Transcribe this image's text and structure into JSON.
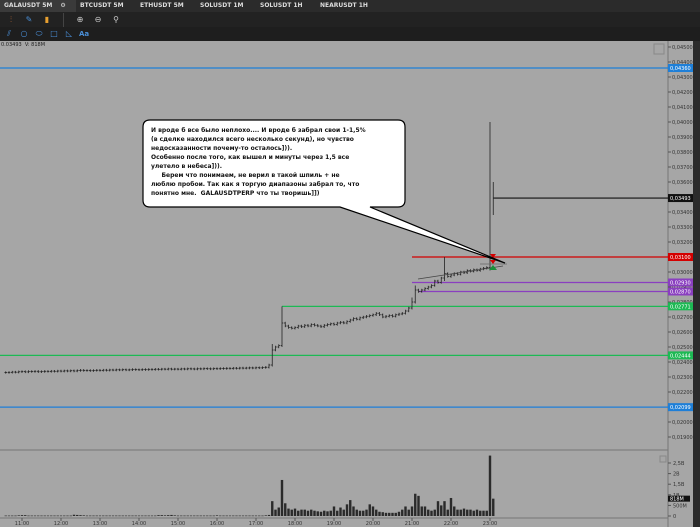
{
  "tabs": [
    {
      "label": "GALAUSDT 5M",
      "active": true
    },
    {
      "label": "BTCUSDT 5M"
    },
    {
      "label": "ETHUSDT 5M"
    },
    {
      "label": "SOLUSDT 1M"
    },
    {
      "label": "SOLUSDT 1H"
    },
    {
      "label": "NEARUSDT 1H"
    }
  ],
  "toolbar": {
    "row1": [
      "indicators-icon",
      "brush-icon",
      "bars-icon",
      "zoom-in-icon",
      "zoom-out-icon",
      "search-icon"
    ],
    "row2": [
      "parallel-lines-icon",
      "circle-icon",
      "ellipse-icon",
      "rectangle-icon",
      "triangle-icon",
      "text-icon"
    ],
    "text_tool_label": "Aa"
  },
  "info": {
    "price": "0.03493",
    "volume": "V: 818M"
  },
  "callout": "И вроде б все было неплохо.... И вроде б забрал свои 1-1,5%\n(в сделке находился всего несколько секунд), но чувство\nнедосказанности почему-то осталось])).\nОсобенно после того, как вышел и минуты через 1,5 все\nулетело в небеса])).\n     Берем что понимаем, не верил в такой шпиль + не\nлюблю пробои. Так как я торгую диапазоны забрал то, что\nпонятно мне.  GALAUSDTPERP что ты творишь]])",
  "colors": {
    "bg": "#a6a6a6",
    "blue": "#1e7fd8",
    "red": "#d40000",
    "purple": "#8a3fc0",
    "green": "#1db954",
    "black": "#111111"
  },
  "chart_data": {
    "type": "candlestick",
    "symbol": "GALAUSDT",
    "interval": "5M",
    "price_ticks": [
      "0,04500",
      "0,04400",
      "0,04300",
      "0,04200",
      "0,04100",
      "0,04000",
      "0,03900",
      "0,03800",
      "0,03700",
      "0,03600",
      "0,03400",
      "0,03300",
      "0,03200",
      "0,03000",
      "0,02900",
      "0,02800",
      "0,02700",
      "0,02600",
      "0,02500",
      "0,02400",
      "0,02300",
      "0,02200",
      "0,02000",
      "0,01900"
    ],
    "volume_ticks": [
      "2,5B",
      "2B",
      "1,5B",
      "1B",
      "500M",
      "0"
    ],
    "time_ticks": [
      "11:00",
      "12:00",
      "13:00",
      "14:00",
      "15:00",
      "16:00",
      "17:00",
      "18:00",
      "19:00",
      "20:00",
      "21:00",
      "22:00",
      "23:00"
    ],
    "levels": [
      {
        "price": 0.0436,
        "label": "0,04360",
        "color": "blue",
        "from": "start"
      },
      {
        "price": 0.03493,
        "label": "0,03493",
        "color": "black",
        "from": "23:05"
      },
      {
        "price": 0.031,
        "label": "0,03100",
        "color": "red",
        "from": "21:00"
      },
      {
        "price": 0.0293,
        "label": "0,02930",
        "color": "purple",
        "from": "21:00"
      },
      {
        "price": 0.0287,
        "label": "0,02870",
        "color": "purple",
        "from": "21:10"
      },
      {
        "price": 0.02771,
        "label": "0,02771",
        "color": "green",
        "from": "17:40"
      },
      {
        "price": 0.02444,
        "label": "0,02444",
        "color": "green",
        "from": "start"
      },
      {
        "price": 0.02099,
        "label": "0,02099",
        "color": "blue",
        "from": "start"
      }
    ],
    "volume_current": "818M",
    "candles_columns": [
      "time",
      "close",
      "volume_B",
      "high",
      "low"
    ],
    "candles": [
      [
        "10:35",
        0.0233,
        0.02
      ],
      [
        "10:40",
        0.02331,
        0.02
      ],
      [
        "10:45",
        0.02333,
        0.02
      ],
      [
        "10:50",
        0.02332,
        0.02
      ],
      [
        "10:55",
        0.02335,
        0.03
      ],
      [
        "11:00",
        0.02336,
        0.04
      ],
      [
        "11:05",
        0.02334,
        0.04
      ],
      [
        "11:10",
        0.02337,
        0.02
      ],
      [
        "11:15",
        0.02336,
        0.02
      ],
      [
        "11:20",
        0.02338,
        0.02
      ],
      [
        "11:25",
        0.02335,
        0.02
      ],
      [
        "11:30",
        0.02336,
        0.02
      ],
      [
        "11:35",
        0.02338,
        0.02
      ],
      [
        "11:40",
        0.02337,
        0.02
      ],
      [
        "11:45",
        0.02339,
        0.02
      ],
      [
        "11:50",
        0.02338,
        0.02
      ],
      [
        "11:55",
        0.0234,
        0.02
      ],
      [
        "12:00",
        0.02339,
        0.02
      ],
      [
        "12:05",
        0.02341,
        0.02
      ],
      [
        "12:10",
        0.0234,
        0.02
      ],
      [
        "12:15",
        0.02342,
        0.02
      ],
      [
        "12:20",
        0.0234,
        0.06
      ],
      [
        "12:25",
        0.02343,
        0.05
      ],
      [
        "12:30",
        0.02345,
        0.04
      ],
      [
        "12:35",
        0.02343,
        0.03
      ],
      [
        "12:40",
        0.02344,
        0.02
      ],
      [
        "12:45",
        0.02342,
        0.02
      ],
      [
        "12:50",
        0.02344,
        0.02
      ],
      [
        "12:55",
        0.02345,
        0.02
      ],
      [
        "13:00",
        0.02344,
        0.02
      ],
      [
        "13:05",
        0.02346,
        0.02
      ],
      [
        "13:10",
        0.02345,
        0.02
      ],
      [
        "13:15",
        0.02347,
        0.02
      ],
      [
        "13:20",
        0.02346,
        0.02
      ],
      [
        "13:25",
        0.02348,
        0.02
      ],
      [
        "13:30",
        0.02347,
        0.02
      ],
      [
        "13:35",
        0.02349,
        0.02
      ],
      [
        "13:40",
        0.02347,
        0.02
      ],
      [
        "13:45",
        0.02348,
        0.02
      ],
      [
        "13:50",
        0.0235,
        0.02
      ],
      [
        "13:55",
        0.02349,
        0.02
      ],
      [
        "14:00",
        0.02348,
        0.02
      ],
      [
        "14:05",
        0.0235,
        0.02
      ],
      [
        "14:10",
        0.02349,
        0.02
      ],
      [
        "14:15",
        0.02351,
        0.02
      ],
      [
        "14:20",
        0.0235,
        0.02
      ],
      [
        "14:25",
        0.02352,
        0.02
      ],
      [
        "14:30",
        0.02351,
        0.04
      ],
      [
        "14:35",
        0.02353,
        0.04
      ],
      [
        "14:40",
        0.02352,
        0.03
      ],
      [
        "14:45",
        0.02354,
        0.04
      ],
      [
        "14:50",
        0.02352,
        0.05
      ],
      [
        "14:55",
        0.02353,
        0.03
      ],
      [
        "15:00",
        0.02352,
        0.02
      ],
      [
        "15:05",
        0.02354,
        0.02
      ],
      [
        "15:10",
        0.02353,
        0.02
      ],
      [
        "15:15",
        0.02355,
        0.02
      ],
      [
        "15:20",
        0.02354,
        0.02
      ],
      [
        "15:25",
        0.02353,
        0.02
      ],
      [
        "15:30",
        0.02355,
        0.02
      ],
      [
        "15:35",
        0.02354,
        0.02
      ],
      [
        "15:40",
        0.02356,
        0.02
      ],
      [
        "15:45",
        0.02355,
        0.02
      ],
      [
        "15:50",
        0.02354,
        0.02
      ],
      [
        "15:55",
        0.02356,
        0.02
      ],
      [
        "16:00",
        0.02355,
        0.03
      ],
      [
        "16:05",
        0.02357,
        0.02
      ],
      [
        "16:10",
        0.02356,
        0.02
      ],
      [
        "16:15",
        0.02358,
        0.02
      ],
      [
        "16:20",
        0.02357,
        0.02
      ],
      [
        "16:25",
        0.02359,
        0.02
      ],
      [
        "16:30",
        0.02358,
        0.02
      ],
      [
        "16:35",
        0.0236,
        0.02
      ],
      [
        "16:40",
        0.02359,
        0.02
      ],
      [
        "16:45",
        0.0236,
        0.02
      ],
      [
        "16:50",
        0.02361,
        0.02
      ],
      [
        "16:55",
        0.0236,
        0.02
      ],
      [
        "17:00",
        0.02362,
        0.02
      ],
      [
        "17:05",
        0.02361,
        0.02
      ],
      [
        "17:10",
        0.02363,
        0.02
      ],
      [
        "17:15",
        0.02365,
        0.03
      ],
      [
        "17:20",
        0.0238,
        0.05
      ],
      [
        "17:25",
        0.0248,
        0.7,
        0.0252,
        0.0237
      ],
      [
        "17:30",
        0.025,
        0.3
      ],
      [
        "17:35",
        0.0251,
        0.4
      ],
      [
        "17:40",
        0.0266,
        1.7,
        0.02771,
        0.025
      ],
      [
        "17:45",
        0.0264,
        0.6
      ],
      [
        "17:50",
        0.0263,
        0.35
      ],
      [
        "17:55",
        0.02625,
        0.3
      ],
      [
        "18:00",
        0.0263,
        0.35
      ],
      [
        "18:05",
        0.0264,
        0.25
      ],
      [
        "18:10",
        0.02635,
        0.3
      ],
      [
        "18:15",
        0.02645,
        0.3
      ],
      [
        "18:20",
        0.0264,
        0.25
      ],
      [
        "18:25",
        0.0265,
        0.3
      ],
      [
        "18:30",
        0.02645,
        0.25
      ],
      [
        "18:35",
        0.0264,
        0.22
      ],
      [
        "18:40",
        0.02635,
        0.2
      ],
      [
        "18:45",
        0.02645,
        0.25
      ],
      [
        "18:50",
        0.0265,
        0.22
      ],
      [
        "18:55",
        0.02655,
        0.25
      ],
      [
        "19:00",
        0.0265,
        0.45
      ],
      [
        "19:05",
        0.0266,
        0.25
      ],
      [
        "19:10",
        0.02665,
        0.4
      ],
      [
        "19:15",
        0.0266,
        0.3
      ],
      [
        "19:20",
        0.0267,
        0.55
      ],
      [
        "19:25",
        0.0268,
        0.75
      ],
      [
        "19:30",
        0.0269,
        0.45
      ],
      [
        "19:35",
        0.02685,
        0.3
      ],
      [
        "19:40",
        0.02695,
        0.25
      ],
      [
        "19:45",
        0.027,
        0.25
      ],
      [
        "19:50",
        0.02705,
        0.3
      ],
      [
        "19:55",
        0.0271,
        0.55
      ],
      [
        "20:00",
        0.02715,
        0.45
      ],
      [
        "20:05",
        0.02725,
        0.3
      ],
      [
        "20:10",
        0.02715,
        0.2
      ],
      [
        "20:15",
        0.027,
        0.18
      ],
      [
        "20:20",
        0.02705,
        0.15
      ],
      [
        "20:25",
        0.0271,
        0.15
      ],
      [
        "20:30",
        0.02705,
        0.15
      ],
      [
        "20:35",
        0.02715,
        0.15
      ],
      [
        "20:40",
        0.0272,
        0.2
      ],
      [
        "20:45",
        0.02725,
        0.3
      ],
      [
        "20:50",
        0.0274,
        0.45
      ],
      [
        "20:55",
        0.0276,
        0.3
      ],
      [
        "21:00",
        0.028,
        0.45,
        0.0283,
        0.0275
      ],
      [
        "21:05",
        0.0288,
        1.05,
        0.0291,
        0.0279
      ],
      [
        "21:10",
        0.0287,
        0.95
      ],
      [
        "21:15",
        0.0288,
        0.45
      ],
      [
        "21:20",
        0.0289,
        0.45
      ],
      [
        "21:25",
        0.029,
        0.3
      ],
      [
        "21:30",
        0.0291,
        0.25
      ],
      [
        "21:35",
        0.0294,
        0.3
      ],
      [
        "21:40",
        0.0293,
        0.7
      ],
      [
        "21:45",
        0.0296,
        0.5
      ],
      [
        "21:50",
        0.0299,
        0.7,
        0.031,
        0.0294
      ],
      [
        "21:55",
        0.0297,
        0.3
      ],
      [
        "22:00",
        0.0298,
        0.85
      ],
      [
        "22:05",
        0.0299,
        0.45
      ],
      [
        "22:10",
        0.02985,
        0.3
      ],
      [
        "22:15",
        0.03,
        0.3
      ],
      [
        "22:20",
        0.02995,
        0.35
      ],
      [
        "22:25",
        0.0301,
        0.3
      ],
      [
        "22:30",
        0.03005,
        0.3
      ],
      [
        "22:35",
        0.03015,
        0.25
      ],
      [
        "22:40",
        0.0301,
        0.3
      ],
      [
        "22:45",
        0.0302,
        0.25
      ],
      [
        "22:50",
        0.03025,
        0.25
      ],
      [
        "22:55",
        0.0303,
        0.25
      ],
      [
        "23:00",
        0.031,
        2.85,
        0.04,
        0.0301
      ],
      [
        "23:05",
        0.03493,
        0.818,
        0.036,
        0.0338
      ]
    ]
  }
}
